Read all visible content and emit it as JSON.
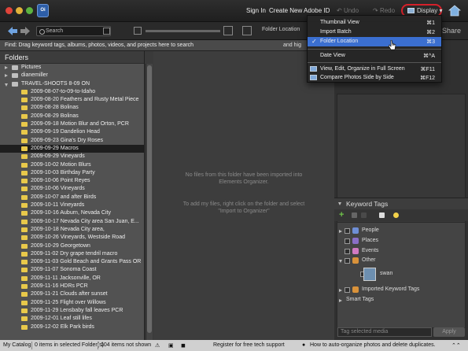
{
  "header": {
    "sign_in": "Sign In",
    "create_id": "Create New Adobe ID",
    "undo": "Undo",
    "redo": "Redo",
    "display": "Display",
    "share": "Share",
    "app_icon": "Oi"
  },
  "nav": {
    "search_placeholder": "Search",
    "folder_location": "Folder Location"
  },
  "findbar": {
    "text": "Find: Drag keyword tags, albums, photos, videos, and projects here to search",
    "trailing": "and hig"
  },
  "folders": {
    "title": "Folders",
    "items": [
      {
        "label": "Pictures",
        "level": 0,
        "expand": "right",
        "grey": true
      },
      {
        "label": "dianemiller",
        "level": 0,
        "expand": "right",
        "grey": true
      },
      {
        "label": "TRAVEL-SHOOTS 8-09 ON",
        "level": 0,
        "expand": "down",
        "grey": true
      },
      {
        "label": "2009-08-07-to-09-to-Idaho",
        "level": 1
      },
      {
        "label": "2009-08-20 Feathers and Rusty Metal Piece",
        "level": 1
      },
      {
        "label": "2009-08-28 Bolinas",
        "level": 1
      },
      {
        "label": "2009-08-29 Bolinas",
        "level": 1
      },
      {
        "label": "2009-09-18 Motion Blur and Orton, PCR",
        "level": 1
      },
      {
        "label": "2009-09-19 Dandelion Head",
        "level": 1
      },
      {
        "label": "2009-09-23 Gina's Dry Roses",
        "level": 1
      },
      {
        "label": "2009-09-29 Macros",
        "level": 1,
        "selected": true
      },
      {
        "label": "2009-09-29 Vineyards",
        "level": 1
      },
      {
        "label": "2009-10-02 Motion Blurs",
        "level": 1
      },
      {
        "label": "2009-10-03 Birthday Party",
        "level": 1
      },
      {
        "label": "2009-10-06 Point Reyes",
        "level": 1
      },
      {
        "label": "2009-10-06 Vineyards",
        "level": 1
      },
      {
        "label": "2009-10-07 and after Birds",
        "level": 1
      },
      {
        "label": "2009-10-11 Vineyards",
        "level": 1
      },
      {
        "label": "2009-10-16 Auburn, Nevada City",
        "level": 1
      },
      {
        "label": "2009-10-17 Nevada City area San Juan, E...",
        "level": 1
      },
      {
        "label": "2009-10-18 Nevada City area,",
        "level": 1
      },
      {
        "label": "2009-10-26 Vineyards, Westside Road",
        "level": 1
      },
      {
        "label": "2009-10-29 Georgetown",
        "level": 1
      },
      {
        "label": "2009-11-02 Dry grape tendril macro",
        "level": 1
      },
      {
        "label": "2009-11-03 Gold Beach and Grants Pass OR",
        "level": 1
      },
      {
        "label": "2009-11-07 Sonoma Coast",
        "level": 1
      },
      {
        "label": "2009-11-11 Jacksonville, OR",
        "level": 1
      },
      {
        "label": "2009-11-16 HDRs PCR",
        "level": 1
      },
      {
        "label": "2009-11-21 Clouds after sunset",
        "level": 1
      },
      {
        "label": "2009-11-25 Flight over Willows",
        "level": 1
      },
      {
        "label": "2009-11-29 Lensbaby fall leaves PCR",
        "level": 1
      },
      {
        "label": "2009-12-01 Leaf still lifes",
        "level": 1
      },
      {
        "label": "2009-12-02 Elk Park birds",
        "level": 1
      }
    ]
  },
  "grid": {
    "empty_message": "No files from this folder have been imported into Elements Organizer.",
    "hint_message": "To add my files, right click on the folder and select \"Import to Organizer\""
  },
  "menu": {
    "items": [
      {
        "label": "Thumbnail View",
        "shortcut": "⌘1"
      },
      {
        "label": "Import Batch",
        "shortcut": "⌘2"
      },
      {
        "label": "Folder Location",
        "shortcut": "⌘3",
        "checked": true,
        "highlighted": true
      },
      {
        "label": "Date View",
        "shortcut": "⌘^A"
      },
      {
        "label": "View, Edit, Organize in Full Screen",
        "shortcut": "⌘F11"
      },
      {
        "label": "Compare Photos Side by Side",
        "shortcut": "⌘F12"
      }
    ]
  },
  "keywords": {
    "title": "Keyword Tags",
    "items": [
      {
        "label": "People",
        "color": "#6f8fd6",
        "expand": "right"
      },
      {
        "label": "Places",
        "color": "#8a6fc7",
        "expand": "none"
      },
      {
        "label": "Events",
        "color": "#d17ac2",
        "expand": "none"
      },
      {
        "label": "Other",
        "color": "#d9923a",
        "expand": "down"
      },
      {
        "label": "swan",
        "color": "",
        "expand": "none",
        "child": true
      },
      {
        "label": "Imported Keyword Tags",
        "color": "#d9923a",
        "expand": "right"
      },
      {
        "label": "Smart Tags",
        "color": "",
        "expand": "right",
        "nobox": true
      }
    ],
    "tag_placeholder": "Tag selected media",
    "apply": "Apply"
  },
  "status": {
    "catalog": "My Catalog",
    "selected": "0 items in selected Folder(s)",
    "not_shown": "104 items not shown",
    "register": "Register for free tech support",
    "tip": "How to auto-organize photos and delete duplicates."
  },
  "colors": {
    "accent_highlight": "#3b6fd0",
    "display_ring": "#d4202a",
    "folder_yellow": "#e8c84a"
  }
}
